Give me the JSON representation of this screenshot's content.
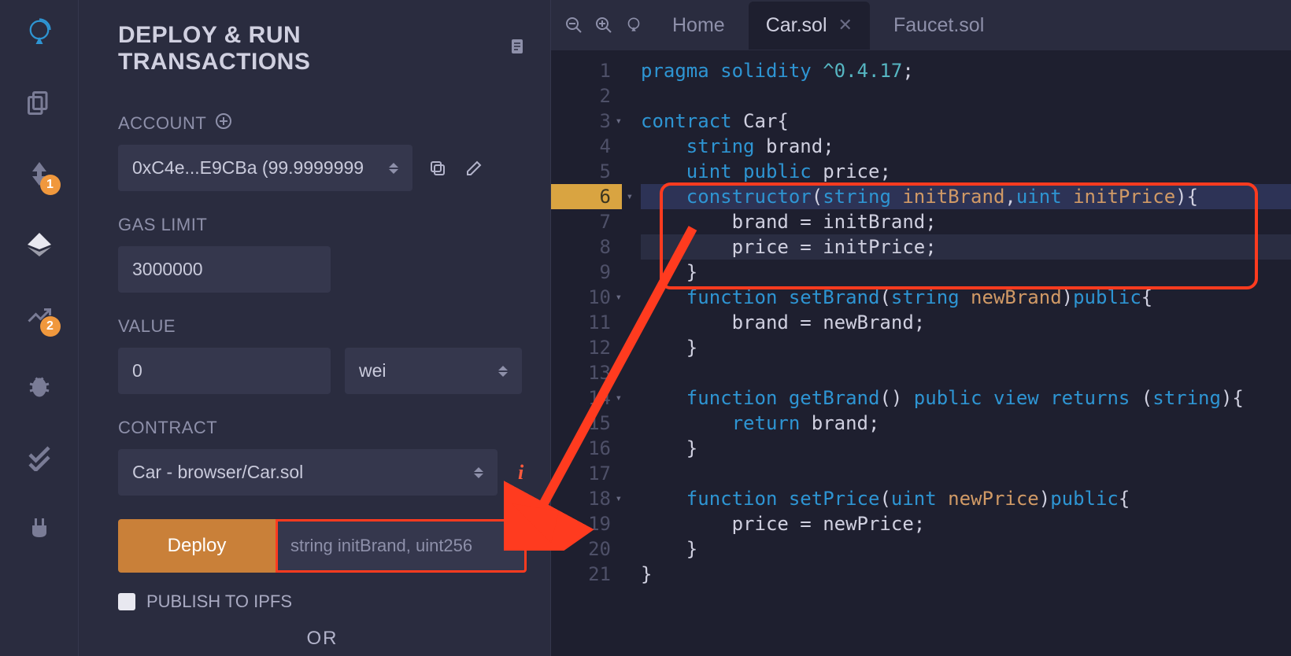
{
  "panel": {
    "title": "DEPLOY & RUN TRANSACTIONS",
    "account_label": "ACCOUNT",
    "account_value": "0xC4e...E9CBa (99.9999999",
    "gas_label": "GAS LIMIT",
    "gas_value": "3000000",
    "value_label": "VALUE",
    "value_value": "0",
    "value_unit": "wei",
    "contract_label": "CONTRACT",
    "contract_value": "Car - browser/Car.sol",
    "deploy_btn": "Deploy",
    "deploy_args_placeholder": "string initBrand, uint256",
    "ipfs_label": "PUBLISH TO IPFS",
    "or_label": "OR"
  },
  "sidebar": {
    "badge1": "1",
    "badge2": "2"
  },
  "tabs": {
    "home": "Home",
    "car": "Car.sol",
    "faucet": "Faucet.sol"
  },
  "code": {
    "lines": [
      {
        "n": "1",
        "tokens": [
          [
            "kw",
            "pragma "
          ],
          [
            "kw",
            "solidity "
          ],
          [
            "ver",
            "^0.4.17"
          ],
          [
            "punc",
            ";"
          ]
        ]
      },
      {
        "n": "2",
        "tokens": []
      },
      {
        "n": "3",
        "fold": true,
        "tokens": [
          [
            "kw",
            "contract "
          ],
          [
            "ident",
            "Car{"
          ]
        ]
      },
      {
        "n": "4",
        "tokens": [
          [
            "punc",
            "    "
          ],
          [
            "type",
            "string "
          ],
          [
            "ident",
            "brand;"
          ]
        ]
      },
      {
        "n": "5",
        "tokens": [
          [
            "punc",
            "    "
          ],
          [
            "type",
            "uint "
          ],
          [
            "kw",
            "public "
          ],
          [
            "ident",
            "price;"
          ]
        ]
      },
      {
        "n": "6",
        "hl": true,
        "fold": true,
        "tokens": [
          [
            "punc",
            "    "
          ],
          [
            "kw",
            "constructor"
          ],
          [
            "punc",
            "("
          ],
          [
            "type",
            "string "
          ],
          [
            "param",
            "initBrand"
          ],
          [
            "punc",
            ","
          ],
          [
            "type",
            "uint "
          ],
          [
            "param",
            "initPrice"
          ],
          [
            "punc",
            "){"
          ]
        ]
      },
      {
        "n": "7",
        "tokens": [
          [
            "punc",
            "        brand = initBrand;"
          ]
        ]
      },
      {
        "n": "8",
        "cursor": true,
        "tokens": [
          [
            "punc",
            "        price = initPrice;"
          ]
        ]
      },
      {
        "n": "9",
        "tokens": [
          [
            "punc",
            "    }"
          ]
        ]
      },
      {
        "n": "10",
        "fold": true,
        "tokens": [
          [
            "punc",
            "    "
          ],
          [
            "kw",
            "function "
          ],
          [
            "kw2",
            "setBrand"
          ],
          [
            "punc",
            "("
          ],
          [
            "type",
            "string "
          ],
          [
            "param",
            "newBrand"
          ],
          [
            "punc",
            ")"
          ],
          [
            "kw",
            "public"
          ],
          [
            "punc",
            "{"
          ]
        ]
      },
      {
        "n": "11",
        "tokens": [
          [
            "punc",
            "        brand = newBrand;"
          ]
        ]
      },
      {
        "n": "12",
        "tokens": [
          [
            "punc",
            "    }"
          ]
        ]
      },
      {
        "n": "13",
        "tokens": []
      },
      {
        "n": "14",
        "fold": true,
        "tokens": [
          [
            "punc",
            "    "
          ],
          [
            "kw",
            "function "
          ],
          [
            "kw2",
            "getBrand"
          ],
          [
            "punc",
            "() "
          ],
          [
            "kw",
            "public "
          ],
          [
            "kw",
            "view "
          ],
          [
            "kw",
            "returns "
          ],
          [
            "punc",
            "("
          ],
          [
            "type",
            "string"
          ],
          [
            "punc",
            "){"
          ]
        ]
      },
      {
        "n": "15",
        "tokens": [
          [
            "punc",
            "        "
          ],
          [
            "kw",
            "return "
          ],
          [
            "ident",
            "brand;"
          ]
        ]
      },
      {
        "n": "16",
        "tokens": [
          [
            "punc",
            "    }"
          ]
        ]
      },
      {
        "n": "17",
        "tokens": []
      },
      {
        "n": "18",
        "fold": true,
        "tokens": [
          [
            "punc",
            "    "
          ],
          [
            "kw",
            "function "
          ],
          [
            "kw2",
            "setPrice"
          ],
          [
            "punc",
            "("
          ],
          [
            "type",
            "uint "
          ],
          [
            "param",
            "newPrice"
          ],
          [
            "punc",
            ")"
          ],
          [
            "kw",
            "public"
          ],
          [
            "punc",
            "{"
          ]
        ]
      },
      {
        "n": "19",
        "tokens": [
          [
            "punc",
            "        price = newPrice;"
          ]
        ]
      },
      {
        "n": "20",
        "tokens": [
          [
            "punc",
            "    }"
          ]
        ]
      },
      {
        "n": "21",
        "tokens": [
          [
            "punc",
            "}"
          ]
        ]
      }
    ]
  }
}
